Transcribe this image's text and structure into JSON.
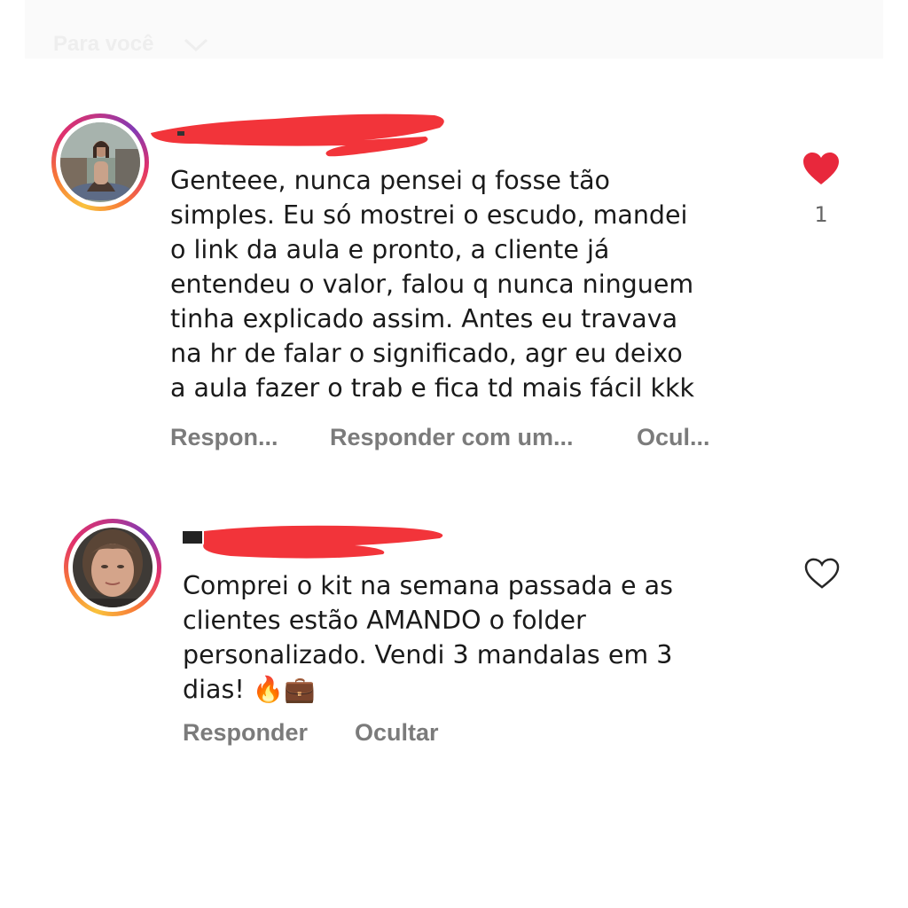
{
  "header": {
    "feed_filter_label": "Para você"
  },
  "comments": [
    {
      "text": "Genteee, nunca pensei q fosse tão\nsimples. Eu só mostrei o escudo, mandei\no link da aula e pronto, a cliente já\nentendeu o valor, falou q nunca ninguem\ntinha explicado assim. Antes eu travava\nna hr de falar o significado, agr eu deixo\na aula fazer o trab e fica td mais fácil kkk",
      "actions": [
        "Respon...",
        "Responder com um...",
        "Ocul..."
      ],
      "liked": true,
      "like_count": "1",
      "like_color": "#e8283c"
    },
    {
      "text": "Comprei o kit na semana passada e as\nclientes estão AMANDO o folder\npersonalizado. Vendi 3 mandalas em 3\ndias! 🔥💼",
      "actions": [
        "Responder",
        "Ocultar"
      ],
      "liked": false,
      "like_count": ""
    }
  ],
  "colors": {
    "redaction": "#f2343a",
    "action_text": "#7b7b7b"
  },
  "icons": {
    "back": "back-arrow-icon",
    "like_filled": "heart-filled-icon",
    "like_outline": "heart-outline-icon",
    "fire": "fire-emoji",
    "briefcase": "briefcase-emoji"
  }
}
